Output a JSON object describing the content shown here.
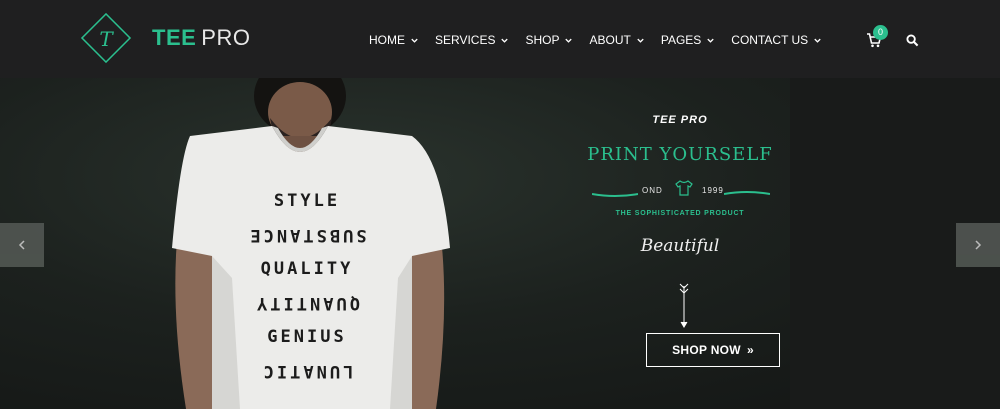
{
  "header": {
    "logo_letter": "T",
    "logo_tee": "TEE",
    "logo_pro": "PRO",
    "nav": [
      {
        "label": "HOME"
      },
      {
        "label": "SERVICES"
      },
      {
        "label": "SHOP"
      },
      {
        "label": "ABOUT"
      },
      {
        "label": "PAGES"
      },
      {
        "label": "CONTACT US"
      }
    ],
    "cart_count": "0",
    "icons": {
      "cart": "cart-icon",
      "search": "search-icon"
    }
  },
  "hero": {
    "small_title": "TEE PRO",
    "title": "PRINT YOURSELF",
    "ond": "OND",
    "year": "1999",
    "tagline": "THE SOPHISTICATED PRODUCT",
    "script": "Beautiful",
    "cta": "SHOP NOW",
    "cta_icon": "»",
    "shirt_print": [
      "STYLE",
      "SUBSTANCE",
      "QUALITY",
      "QUANTITY",
      "GENIUS",
      "LUNATIC"
    ]
  },
  "colors": {
    "accent": "#2bbf8e",
    "header_bg": "#1f1f20",
    "text": "#ffffff"
  }
}
